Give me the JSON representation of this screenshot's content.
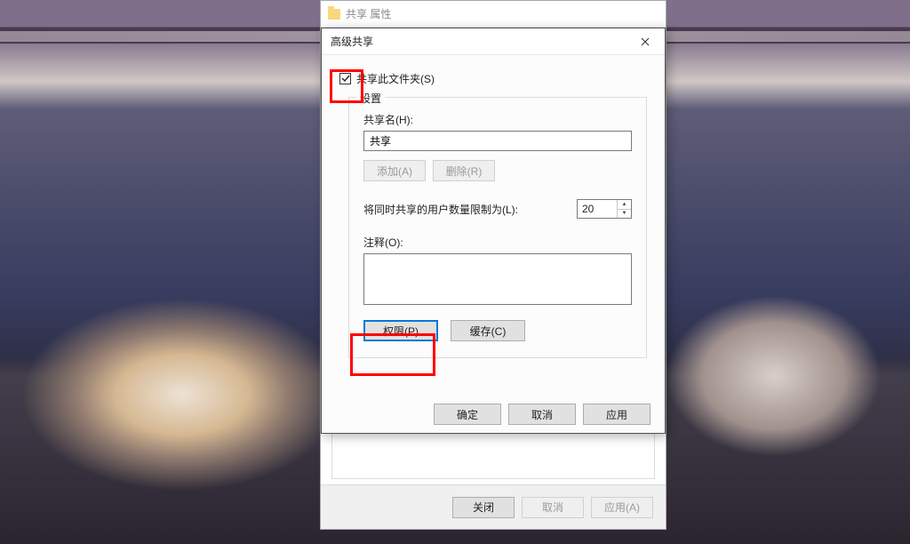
{
  "parent_dialog": {
    "title": "共享 属性",
    "footer": {
      "close": "关闭",
      "cancel": "取消",
      "apply": "应用(A)"
    }
  },
  "adv_dialog": {
    "title": "高级共享",
    "checkbox_label": "共享此文件夹(S)",
    "checkbox_checked": true,
    "group_legend": "设置",
    "share_name_label": "共享名(H):",
    "share_name_value": "共享",
    "add_button": "添加(A)",
    "remove_button": "删除(R)",
    "limit_label": "将同时共享的用户数量限制为(L):",
    "limit_value": "20",
    "comment_label": "注释(O):",
    "comment_value": "",
    "permissions_button": "权限(P)",
    "cache_button": "缓存(C)",
    "footer": {
      "ok": "确定",
      "cancel": "取消",
      "apply": "应用"
    }
  }
}
